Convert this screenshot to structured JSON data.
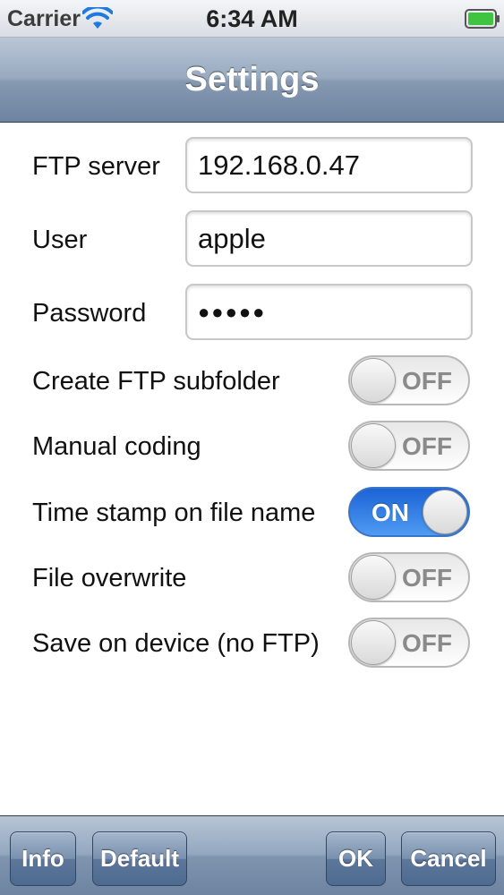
{
  "status_bar": {
    "carrier": "Carrier",
    "time": "6:34 AM",
    "icons": [
      "wifi-icon",
      "battery-icon"
    ]
  },
  "nav": {
    "title": "Settings"
  },
  "form": {
    "ftp_server": {
      "label": "FTP server",
      "value": "192.168.0.47"
    },
    "user": {
      "label": "User",
      "value": "apple"
    },
    "password": {
      "label": "Password",
      "value": "●●●●●"
    }
  },
  "toggles": [
    {
      "label": "Create FTP subfolder",
      "state": "OFF",
      "on": false
    },
    {
      "label": "Manual coding",
      "state": "OFF",
      "on": false
    },
    {
      "label": "Time stamp on file name",
      "state": "ON",
      "on": true
    },
    {
      "label": "File overwrite",
      "state": "OFF",
      "on": false
    },
    {
      "label": "Save on device (no FTP)",
      "state": "OFF",
      "on": false
    }
  ],
  "toolbar": {
    "info": "Info",
    "default": "Default",
    "ok": "OK",
    "cancel": "Cancel"
  },
  "colors": {
    "nav_bar": "#8699b1",
    "toggle_on": "#2f7de6",
    "toggle_off": "#f0f0f0"
  }
}
